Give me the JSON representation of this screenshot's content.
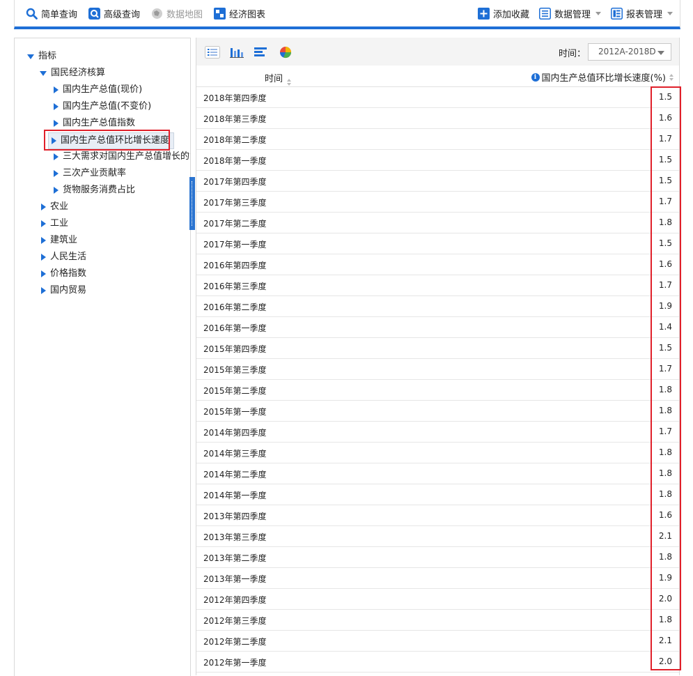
{
  "toolbar": {
    "left": [
      {
        "label": "简单查询",
        "icon": "search-icon",
        "disabled": false
      },
      {
        "label": "高级查询",
        "icon": "advanced-search-icon",
        "disabled": false
      },
      {
        "label": "数据地图",
        "icon": "map-icon",
        "disabled": true
      },
      {
        "label": "经济图表",
        "icon": "chart-grid-icon",
        "disabled": false
      }
    ],
    "right": [
      {
        "label": "添加收藏",
        "icon": "plus-icon",
        "dropdown": false
      },
      {
        "label": "数据管理",
        "icon": "data-manage-icon",
        "dropdown": true
      },
      {
        "label": "报表管理",
        "icon": "report-manage-icon",
        "dropdown": true
      }
    ]
  },
  "tree": {
    "root": "指标",
    "group": "国民经济核算",
    "group_children": [
      "国内生产总值(现价)",
      "国内生产总值(不变价)",
      "国内生产总值指数",
      "国内生产总值环比增长速度",
      "三大需求对国内生产总值增长的贡献",
      "三次产业贡献率",
      "货物服务消费占比"
    ],
    "selected_index": 3,
    "top_level": [
      "农业",
      "工业",
      "建筑业",
      "人民生活",
      "价格指数",
      "国内贸易"
    ]
  },
  "view_icons": [
    "table-view-icon",
    "bar-chart-icon",
    "horizontal-bar-icon",
    "pie-chart-icon"
  ],
  "time_filter": {
    "label": "时间：",
    "value": "2012A-2018D"
  },
  "table": {
    "col_time": "时间",
    "col_value": "国内生产总值环比增长速度(%)",
    "rows": [
      {
        "time": "2018年第四季度",
        "value": "1.5"
      },
      {
        "time": "2018年第三季度",
        "value": "1.6"
      },
      {
        "time": "2018年第二季度",
        "value": "1.7"
      },
      {
        "time": "2018年第一季度",
        "value": "1.5"
      },
      {
        "time": "2017年第四季度",
        "value": "1.5"
      },
      {
        "time": "2017年第三季度",
        "value": "1.7"
      },
      {
        "time": "2017年第二季度",
        "value": "1.8"
      },
      {
        "time": "2017年第一季度",
        "value": "1.5"
      },
      {
        "time": "2016年第四季度",
        "value": "1.6"
      },
      {
        "time": "2016年第三季度",
        "value": "1.7"
      },
      {
        "time": "2016年第二季度",
        "value": "1.9"
      },
      {
        "time": "2016年第一季度",
        "value": "1.4"
      },
      {
        "time": "2015年第四季度",
        "value": "1.5"
      },
      {
        "time": "2015年第三季度",
        "value": "1.7"
      },
      {
        "time": "2015年第二季度",
        "value": "1.8"
      },
      {
        "time": "2015年第一季度",
        "value": "1.8"
      },
      {
        "time": "2014年第四季度",
        "value": "1.7"
      },
      {
        "time": "2014年第三季度",
        "value": "1.8"
      },
      {
        "time": "2014年第二季度",
        "value": "1.8"
      },
      {
        "time": "2014年第一季度",
        "value": "1.8"
      },
      {
        "time": "2013年第四季度",
        "value": "1.6"
      },
      {
        "time": "2013年第三季度",
        "value": "2.1"
      },
      {
        "time": "2013年第二季度",
        "value": "1.8"
      },
      {
        "time": "2013年第一季度",
        "value": "1.9"
      },
      {
        "time": "2012年第四季度",
        "value": "2.0"
      },
      {
        "time": "2012年第三季度",
        "value": "1.8"
      },
      {
        "time": "2012年第二季度",
        "value": "2.1"
      },
      {
        "time": "2012年第一季度",
        "value": "2.0"
      }
    ]
  },
  "colors": {
    "accent": "#1e6fd6",
    "highlight": "#e0202a"
  }
}
